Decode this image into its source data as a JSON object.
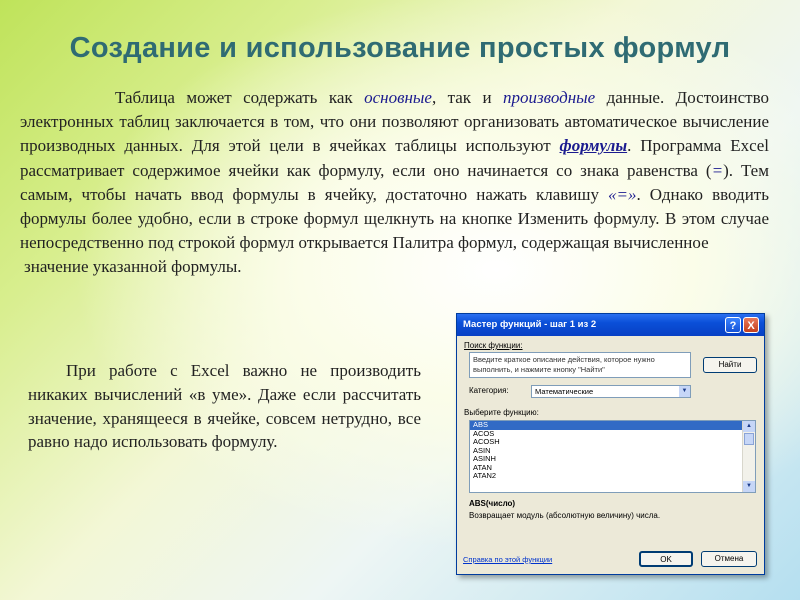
{
  "slide": {
    "title": "Создание и использование простых формул",
    "para1": {
      "t1": "Таблица может содержать как ",
      "h1": "основные",
      "t2": ", так и ",
      "h2": "производные",
      "t3": " данные. Достоинство электронных таблиц заключается в том, что они позволяют организовать автоматическое вычисление производных данных. Для этой цели в ячейках таблицы используют ",
      "h3": "формулы",
      "t4": ". Программа Excel рассматривает содержимое ячейки как формулу, если оно начинается со знака равенства (",
      "h4": "=",
      "t5": "). Тем самым, чтобы начать ввод формулы в ячейку, достаточно нажать клавишу ",
      "h5": "«=»",
      "t6": ". Однако вводить формулы более удобно, если в строке формул щелкнуть на кнопке  Изменить формулу. В этом случае непосредственно под строкой формул открывается Палитра формул, содержащая вычисленное",
      "last": "значение указанной формулы."
    },
    "para2": "При работе с Excel важно не производить никаких вычислений «в уме». Даже если рассчитать значение, хранящееся в ячейке, совсем нетрудно, все равно надо использовать формулу."
  },
  "dialog": {
    "title": "Мастер функций - шаг 1 из 2",
    "help_glyph": "?",
    "close_glyph": "X",
    "search_label": "Поиск функции:",
    "search_text": "Введите краткое описание действия, которое нужно выполнить, и нажмите кнопку \"Найти\"",
    "find_button": "Найти",
    "category_label": "Категория:",
    "category_value": "Математические",
    "select_label": "Выберите функцию:",
    "functions": [
      "ABS",
      "ACOS",
      "ACOSH",
      "ASIN",
      "ASINH",
      "ATAN",
      "ATAN2"
    ],
    "selected_function": "ABS",
    "signature": "ABS(число)",
    "description": "Возвращает модуль (абсолютную величину) числа.",
    "help_link": "Справка по этой функции",
    "ok_button": "OK",
    "cancel_button": "Отмена"
  }
}
